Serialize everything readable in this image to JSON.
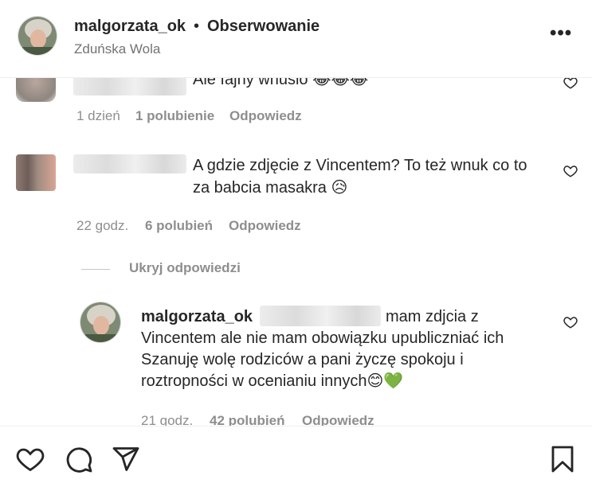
{
  "header": {
    "username": "malgorzata_ok",
    "separator": "•",
    "follow_label": "Obserwowanie",
    "location": "Zduńska Wola",
    "more_label": "•••"
  },
  "comments": [
    {
      "text": "Ale fajny wnusio",
      "emojis": "😂😂😂",
      "time": "1 dzień",
      "likes": "1 polubienie",
      "reply_label": "Odpowiedz"
    },
    {
      "text_line1": "A gdzie zdjęcie z Vincentem? To też wnuk co to",
      "text_line2": "za babcia masakra",
      "emoji": "😥",
      "time": "22 godz.",
      "likes": "6 polubień",
      "reply_label": "Odpowiedz"
    }
  ],
  "hide_replies_label": "Ukryj odpowiedzi",
  "reply": {
    "username": "malgorzata_ok",
    "line1": "mam zdjcia z",
    "line2": "Vincentem ale nie mam obowiązku upubliczniać ich",
    "line3": "Szanuję wolę rodziców a pani życzę spokoju i",
    "line4": "roztropności w ocenianiu innych",
    "emojis": "😊💚",
    "time": "21 godz.",
    "likes": "42 polubień",
    "reply_label": "Odpowiedz"
  },
  "icons": {
    "like": "heart-icon",
    "comment": "comment-icon",
    "share": "send-icon",
    "save": "bookmark-icon"
  }
}
